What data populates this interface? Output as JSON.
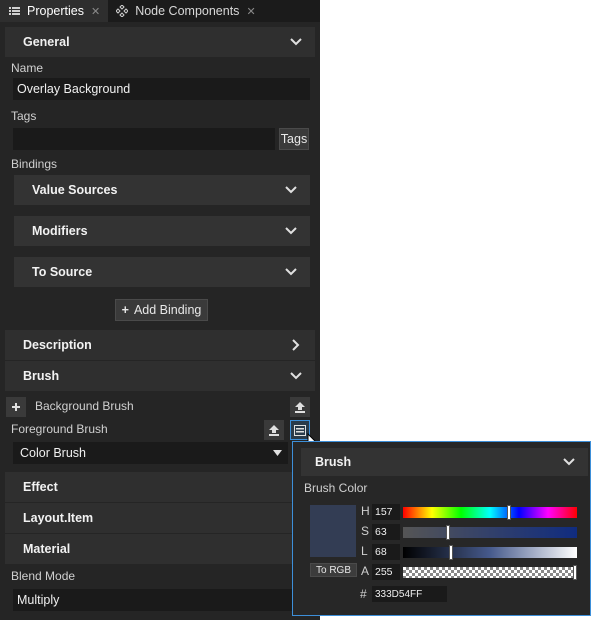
{
  "tabs": [
    {
      "label": "Properties",
      "icon": "list-icon",
      "active": true
    },
    {
      "label": "Node Components",
      "icon": "components-icon",
      "active": false
    }
  ],
  "sections": {
    "general": "General",
    "description": "Description",
    "brush": "Brush",
    "effect": "Effect",
    "layout": "Layout.Item",
    "material": "Material"
  },
  "name": {
    "label": "Name",
    "value": "Overlay Background"
  },
  "tags": {
    "label": "Tags",
    "value": "",
    "button": "Tags"
  },
  "bindings": {
    "label": "Bindings",
    "groups": [
      "Value Sources",
      "Modifiers",
      "To Source"
    ],
    "add_button": "Add Binding",
    "add_icon": "+"
  },
  "brush": {
    "background_label": "Background Brush",
    "foreground_label": "Foreground Brush",
    "foreground_value": "Color Brush"
  },
  "blend": {
    "label": "Blend Mode",
    "value": "Multiply"
  },
  "popup": {
    "title": "Brush",
    "color_label": "Brush Color",
    "swatch_color": "#333d54",
    "h_label": "H",
    "h_value": "157",
    "h_fraction": 0.61,
    "s_label": "S",
    "s_value": "63",
    "s_fraction": 0.25,
    "l_label": "L",
    "l_value": "68",
    "l_fraction": 0.27,
    "a_label": "A",
    "a_value": "255",
    "a_fraction": 1.0,
    "to_rgb": "To RGB",
    "hex_label": "#",
    "hex_value": "333D54FF"
  },
  "colors": {
    "accent": "#3d8fd9",
    "panel": "#252525",
    "section": "#2f2f2f"
  }
}
